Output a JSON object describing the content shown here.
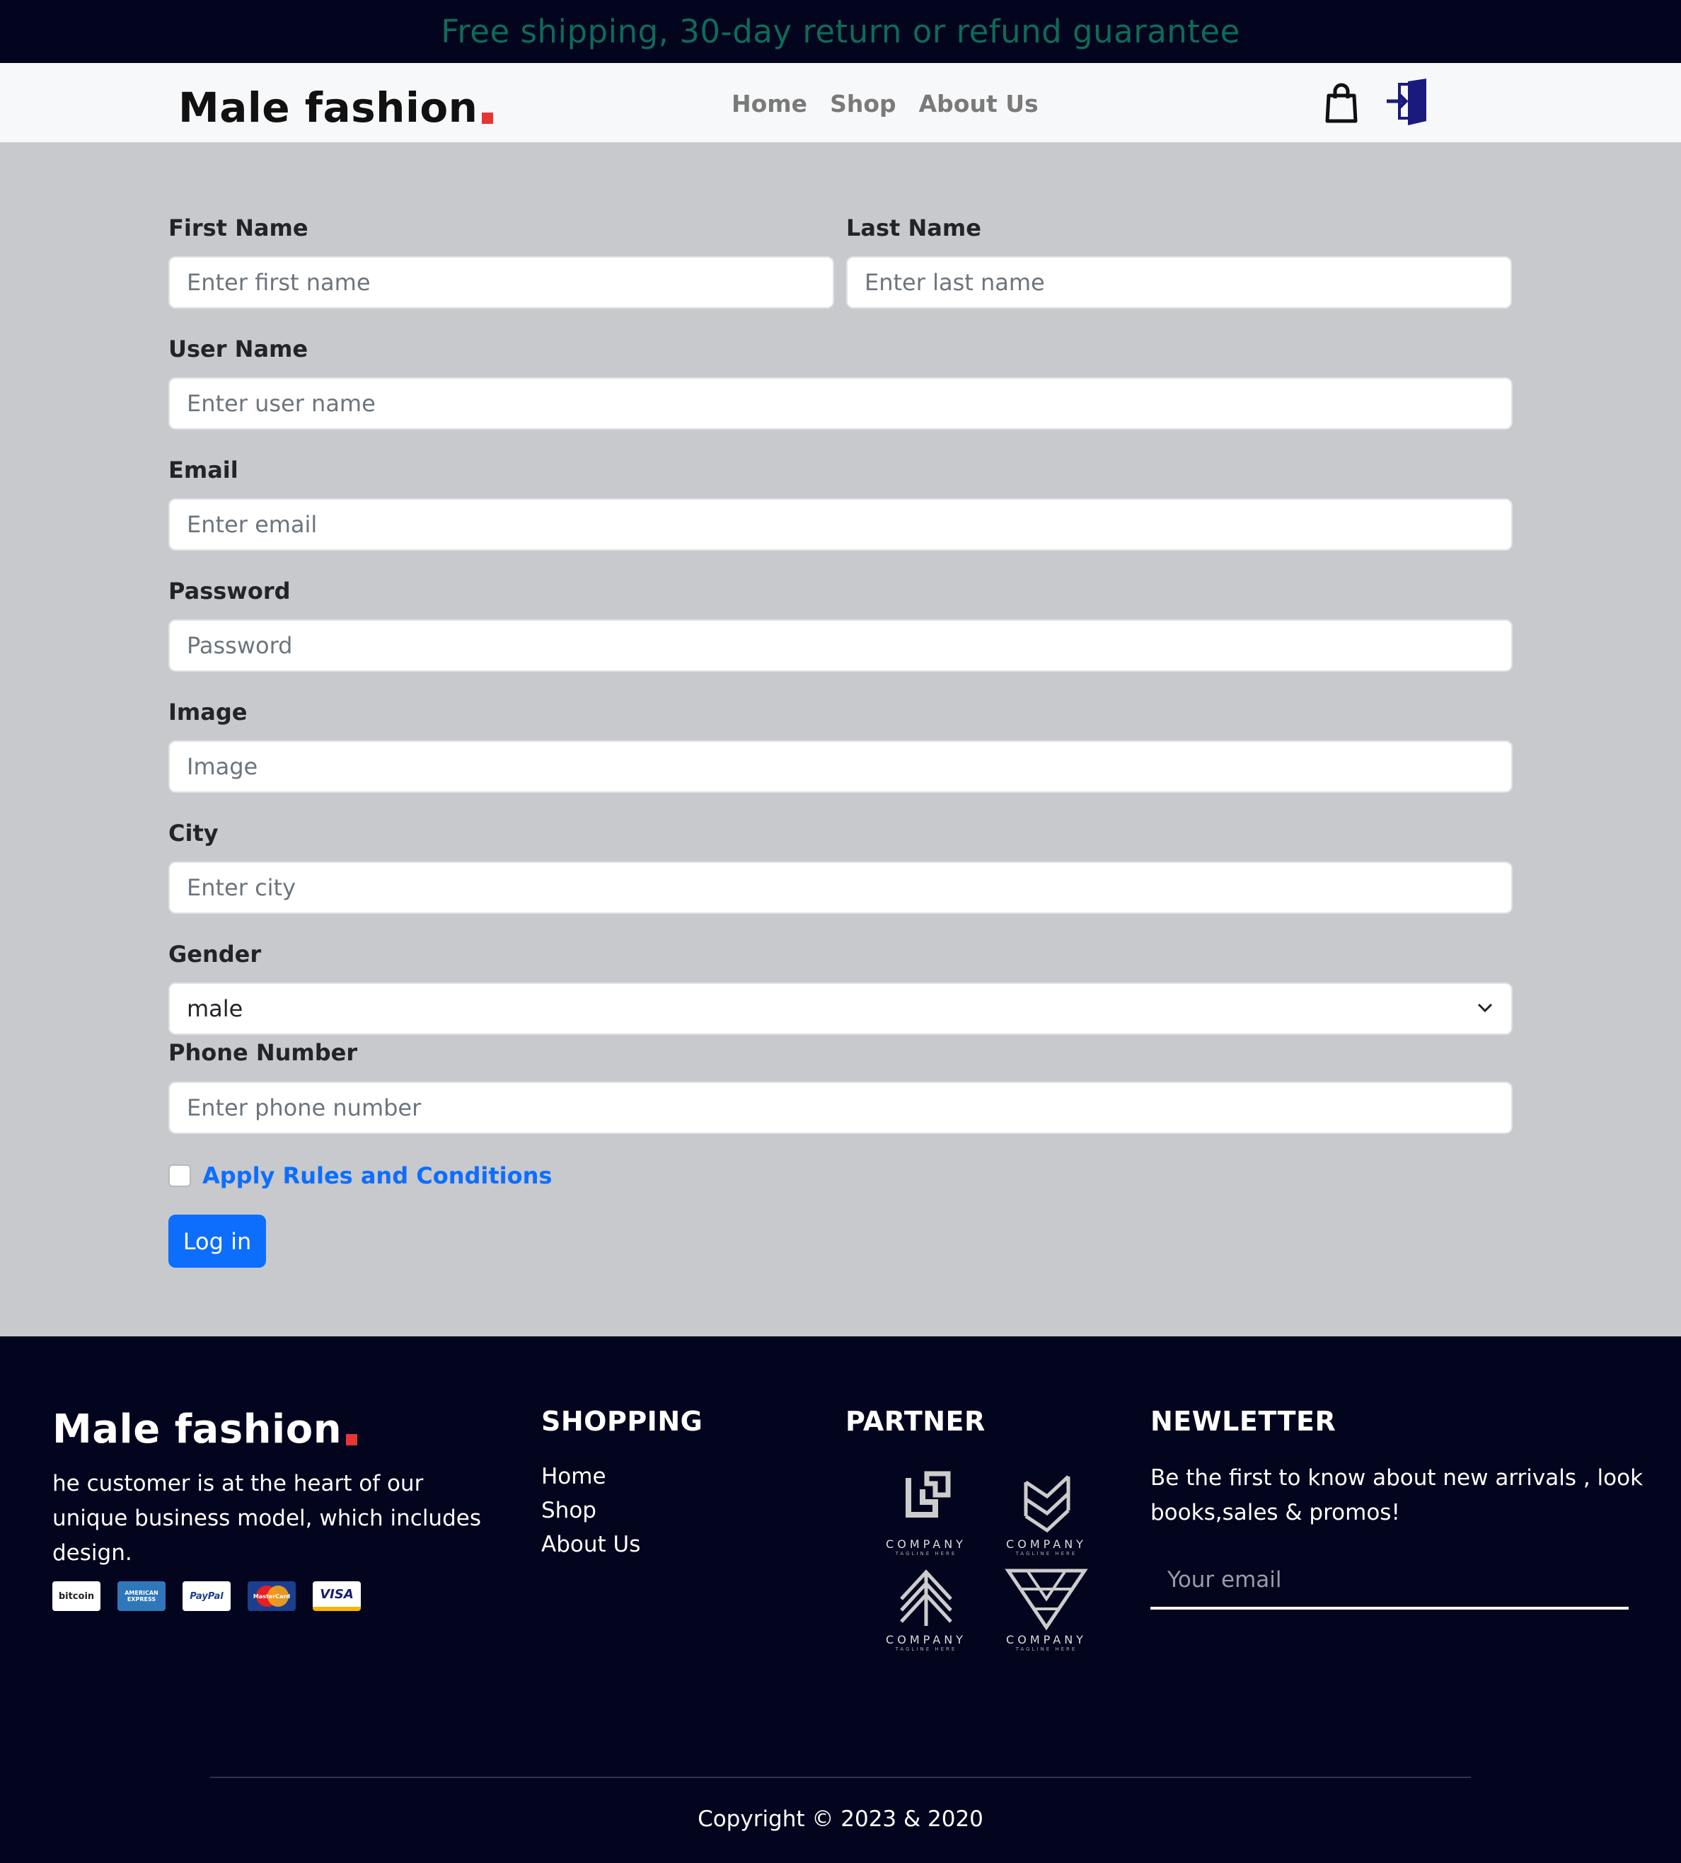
{
  "promo": {
    "text": "Free shipping, 30-day return or refund guarantee"
  },
  "header": {
    "logo_text": "Male fashion",
    "nav": [
      "Home",
      "Shop",
      "About Us"
    ]
  },
  "form": {
    "first_name": {
      "label": "First Name",
      "placeholder": "Enter first name"
    },
    "last_name": {
      "label": "Last Name",
      "placeholder": "Enter last name"
    },
    "user_name": {
      "label": "User Name",
      "placeholder": "Enter user name"
    },
    "email": {
      "label": "Email",
      "placeholder": "Enter email"
    },
    "password": {
      "label": "Password",
      "placeholder": "Password"
    },
    "image": {
      "label": "Image",
      "placeholder": "Image"
    },
    "city": {
      "label": "City",
      "placeholder": "Enter city"
    },
    "gender": {
      "label": "Gender",
      "value": "male"
    },
    "phone": {
      "label": "Phone Number",
      "placeholder": "Enter phone number"
    },
    "rules_label": "Apply Rules and Conditions",
    "submit_label": "Log in"
  },
  "footer": {
    "logo_text": "Male fashion",
    "about": "he customer is at the heart of our unique business model, which includes design.",
    "payments": [
      "bitcoin",
      "AMERICAN EXPRESS",
      "PayPal",
      "MasterCard",
      "VISA"
    ],
    "shopping_heading": "SHOPPING",
    "shopping_links": [
      "Home",
      "Shop",
      "About Us"
    ],
    "partner_heading": "PARTNER",
    "partner_label": "COMPANY",
    "partner_tagline": "TAGLINE HERE",
    "newsletter_heading": "NEWLETTER",
    "newsletter_text": "Be the first to know about new arrivals , look books,sales & promos!",
    "email_placeholder": "Your email",
    "copyright": "Copyright © 2023 & 2020"
  },
  "colors": {
    "dark_bg": "#03041d",
    "promo_text": "#0e6b57",
    "brand_dot": "#e53637",
    "primary": "#0d6efd",
    "form_bg": "#c8c9cc",
    "login_icon": "#1a1a7e"
  },
  "icons": [
    "shopping-bag-icon",
    "login-door-icon",
    "chevron-down-icon"
  ]
}
